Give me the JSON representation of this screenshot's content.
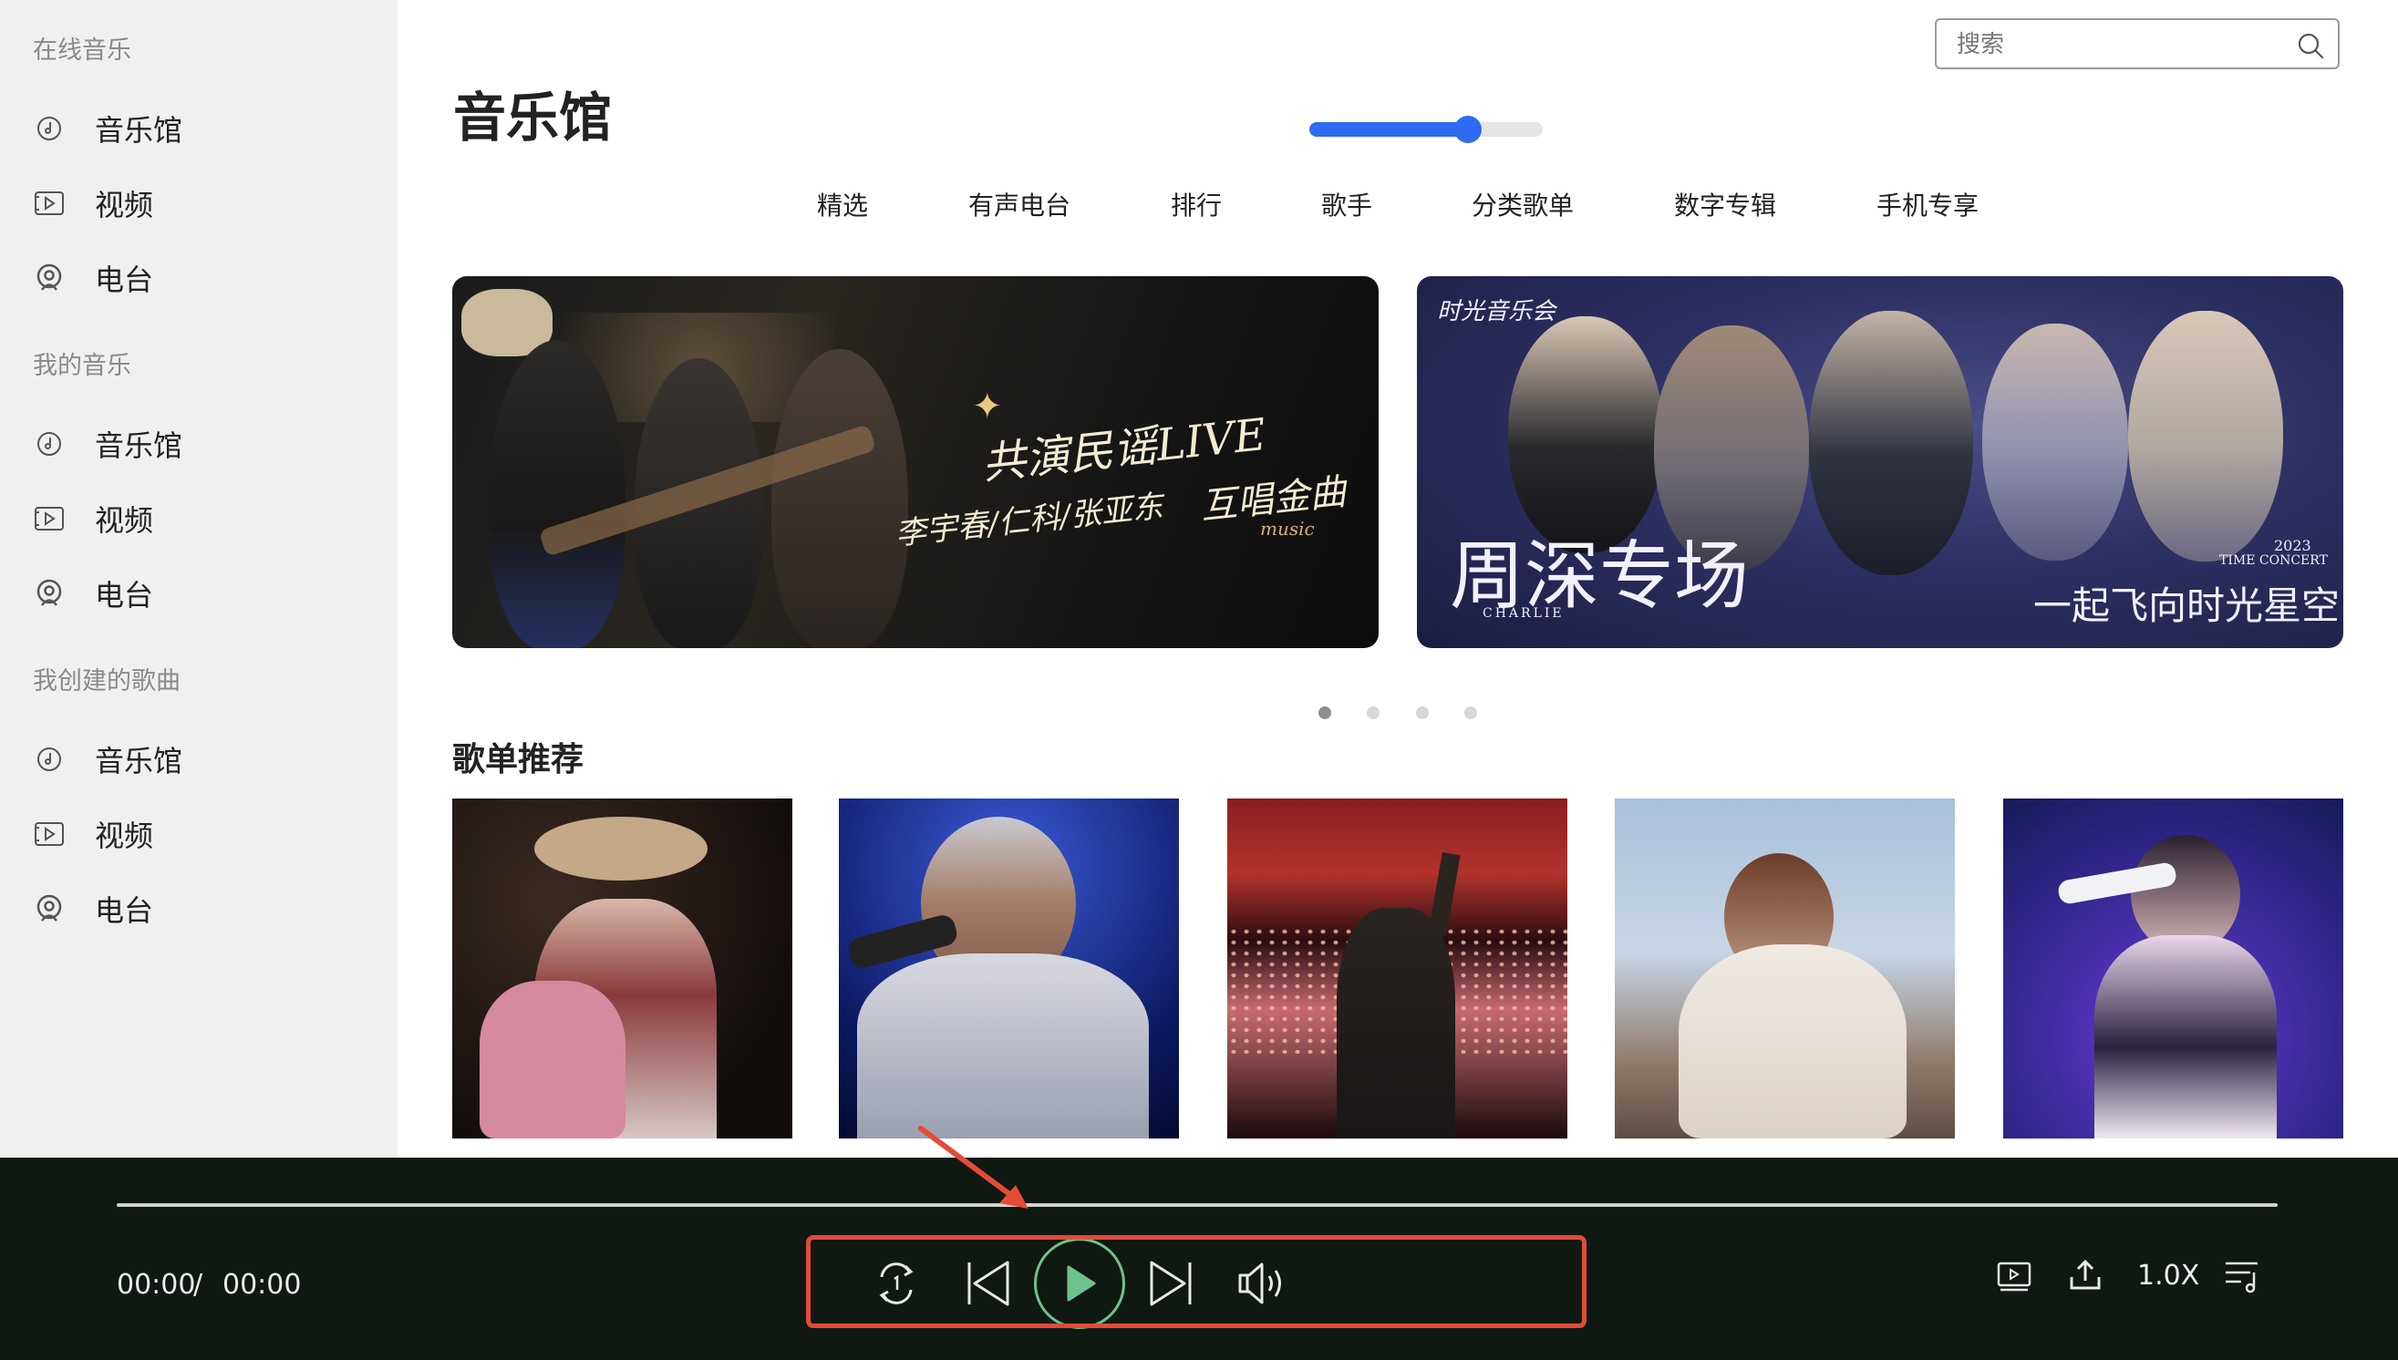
{
  "sidebar": {
    "sections": [
      {
        "title": "在线音乐",
        "items": [
          {
            "label": "音乐馆",
            "icon": "music-disc-icon"
          },
          {
            "label": "视频",
            "icon": "video-icon"
          },
          {
            "label": "电台",
            "icon": "radio-icon"
          }
        ]
      },
      {
        "title": "我的音乐",
        "items": [
          {
            "label": "音乐馆",
            "icon": "music-disc-icon"
          },
          {
            "label": "视频",
            "icon": "video-icon"
          },
          {
            "label": "电台",
            "icon": "radio-icon"
          }
        ]
      },
      {
        "title": "我创建的歌曲",
        "items": [
          {
            "label": "音乐馆",
            "icon": "music-disc-icon"
          },
          {
            "label": "视频",
            "icon": "video-icon"
          },
          {
            "label": "电台",
            "icon": "radio-icon"
          }
        ]
      }
    ]
  },
  "search": {
    "placeholder": "搜索",
    "value": ""
  },
  "page_title": "音乐馆",
  "tabs": [
    "精选",
    "有声电台",
    "排行",
    "歌手",
    "分类歌单",
    "数字专辑",
    "手机专享"
  ],
  "banners": [
    {
      "text_main": "共演民谣LIVE",
      "text_sub": "李宇春/仁科/张亚东",
      "text_tag": "互唱金曲",
      "text_music": "music"
    },
    {
      "text_brand": "时光音乐会",
      "text_main": "周深专场",
      "text_sub": "CHARLIE",
      "text_year": "2023",
      "text_concert": "TIME CONCERT",
      "text_tagline": "一起飞向时光星空"
    }
  ],
  "carousel": {
    "count": 4,
    "active": 0
  },
  "playlist_section_title": "歌单推荐",
  "player": {
    "current_time": "00:00",
    "separator": "/",
    "total_time": "00:00",
    "progress": 0,
    "volume": 0.68,
    "speed": "1.0X"
  },
  "colors": {
    "sidebar_bg": "#f0f0f0",
    "player_bg": "#0f1811",
    "accent_blue": "#2f6bf0",
    "play_green": "#6cc38c",
    "highlight_red": "#e54a36"
  }
}
